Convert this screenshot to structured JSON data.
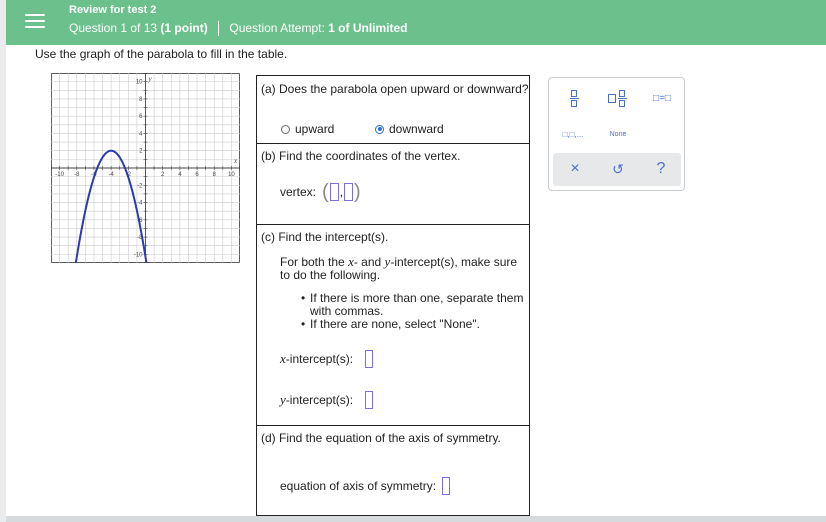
{
  "header": {
    "title": "Review for test 2",
    "question": "Question 1 of 13",
    "points": "(1 point)",
    "attempt_label": "Question Attempt:",
    "attempt_value": "1 of Unlimited"
  },
  "instruction": "Use the graph of the parabola to fill in the table.",
  "graph": {
    "x_label": "x",
    "y_label": "y",
    "x_ticks": [
      "-10",
      "-8",
      "-6",
      "-4",
      "-2",
      "2",
      "4",
      "6",
      "8",
      "10"
    ],
    "y_ticks": [
      "10",
      "8",
      "6",
      "4",
      "2",
      "-2",
      "-4",
      "-6",
      "-8",
      "-10"
    ],
    "curve_color": "#2b3bb0",
    "axis_range": [
      -11,
      11
    ]
  },
  "part_a": {
    "question": "(a) Does the parabola open upward or downward?",
    "options": [
      "upward",
      "downward"
    ],
    "selected": "downward"
  },
  "part_b": {
    "question": "(b) Find the coordinates of the vertex.",
    "vertex_label": "vertex:"
  },
  "part_c": {
    "question": "(c) Find the intercept(s).",
    "intro_1": "For both the",
    "intro_x": "x",
    "intro_2": "- and",
    "intro_y": "y",
    "intro_3": "-intercept(s), make sure to do the following.",
    "bullets": [
      "If there is more than one, separate them with commas.",
      "If there are none, select \"None\"."
    ],
    "x_var": "x",
    "x_label": "-intercept(s):",
    "y_var": "y",
    "y_label": "-intercept(s):"
  },
  "part_d": {
    "question": "(d) Find the equation of the axis of symmetry.",
    "label": "equation of axis of symmetry:"
  },
  "palette": {
    "none_label": "None",
    "list_label": "□,□,...",
    "eq_label": "□=□",
    "clear_icon": "×",
    "undo_icon": "↺",
    "help_icon": "?"
  },
  "colors": {
    "header": "#6cc08c",
    "accent": "#2a6fc9",
    "input_border": "#7b6ee0"
  }
}
